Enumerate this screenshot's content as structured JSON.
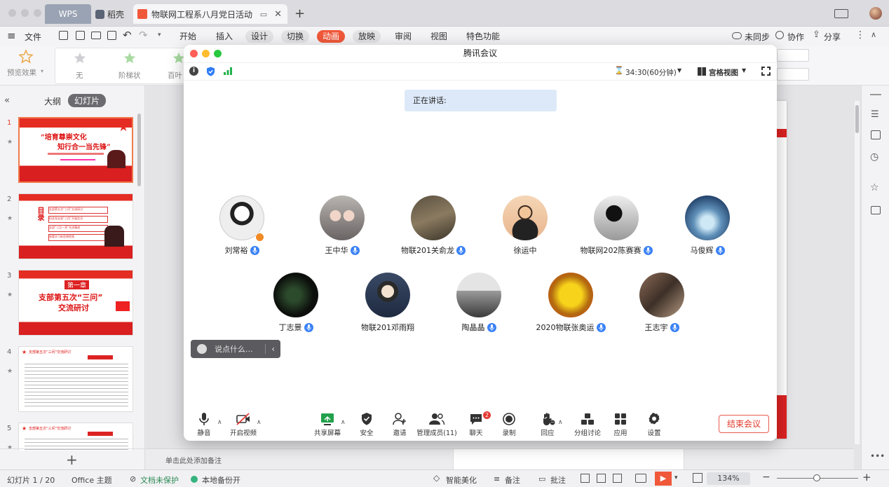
{
  "wps": {
    "tabs": {
      "wps": "WPS",
      "daoke": "稻壳",
      "doc": "物联网工程系八月党日活动"
    },
    "menu": {
      "file": "文件"
    },
    "ribbon_tabs": [
      "开始",
      "插入",
      "设计",
      "切换",
      "动画",
      "放映",
      "审阅",
      "视图",
      "特色功能"
    ],
    "right_actions": {
      "sync": "未同步",
      "collab": "协作",
      "share": "分享"
    },
    "effects": {
      "preview": "预览效果",
      "none": "无",
      "ladder": "阶梯状",
      "blinds": "百叶"
    },
    "panel_tabs": {
      "outline": "大纲",
      "slides": "幻灯片"
    },
    "slides": [
      {
        "num": "1",
        "line1": "“培育尊崇文化",
        "line2": "知行合一当先锋”"
      },
      {
        "num": "2",
        "title": "目录",
        "items": [
          "支部第五次“三问”交流研讨",
          "机关党支部“三问”开展实况",
          "支部“三比一亮”先进事迹",
          "观看学习新思想视频"
        ]
      },
      {
        "num": "3",
        "chapter": "第一章",
        "line1": "支部第五次“三问”",
        "line2": "交流研讨"
      },
      {
        "num": "4",
        "heading": "支部第五次“三问”交流研讨"
      },
      {
        "num": "5",
        "heading": "支部第五次“三问”交流研讨"
      }
    ],
    "notes_placeholder": "单击此处添加备注",
    "status": {
      "slide_count": "幻灯片 1 / 20",
      "theme": "Office 主题",
      "unprotected": "文档未保护",
      "backup": "本地备份开",
      "beautify": "智能美化",
      "notes": "备注",
      "comments": "批注",
      "zoom": "134%"
    }
  },
  "meeting": {
    "title": "腾讯会议",
    "timer": "34:30(60分钟)",
    "view_mode": "宫格视图",
    "speaking_label": "正在讲话:",
    "participants": [
      {
        "name": "刘常裕",
        "host": true
      },
      {
        "name": "王中华"
      },
      {
        "name": "物联201关俞龙"
      },
      {
        "name": "徐运中",
        "no_mic": true
      },
      {
        "name": "物联网202陈赛赛"
      },
      {
        "name": "马俊辉"
      },
      {
        "name": "丁志景"
      },
      {
        "name": "物联201邓雨翔",
        "no_mic": true
      },
      {
        "name": "陶晶晶"
      },
      {
        "name": "2020物联张奥运"
      },
      {
        "name": "王志宇"
      }
    ],
    "chat_placeholder": "说点什么...",
    "toolbar": {
      "mute": "静音",
      "video": "开启视频",
      "share": "共享屏幕",
      "security": "安全",
      "invite": "邀请",
      "members": "管理成员(11)",
      "chat": "聊天",
      "chat_badge": "2",
      "record": "录制",
      "react": "回应",
      "breakout": "分组讨论",
      "apps": "应用",
      "settings": "设置",
      "end": "结束会议"
    }
  }
}
